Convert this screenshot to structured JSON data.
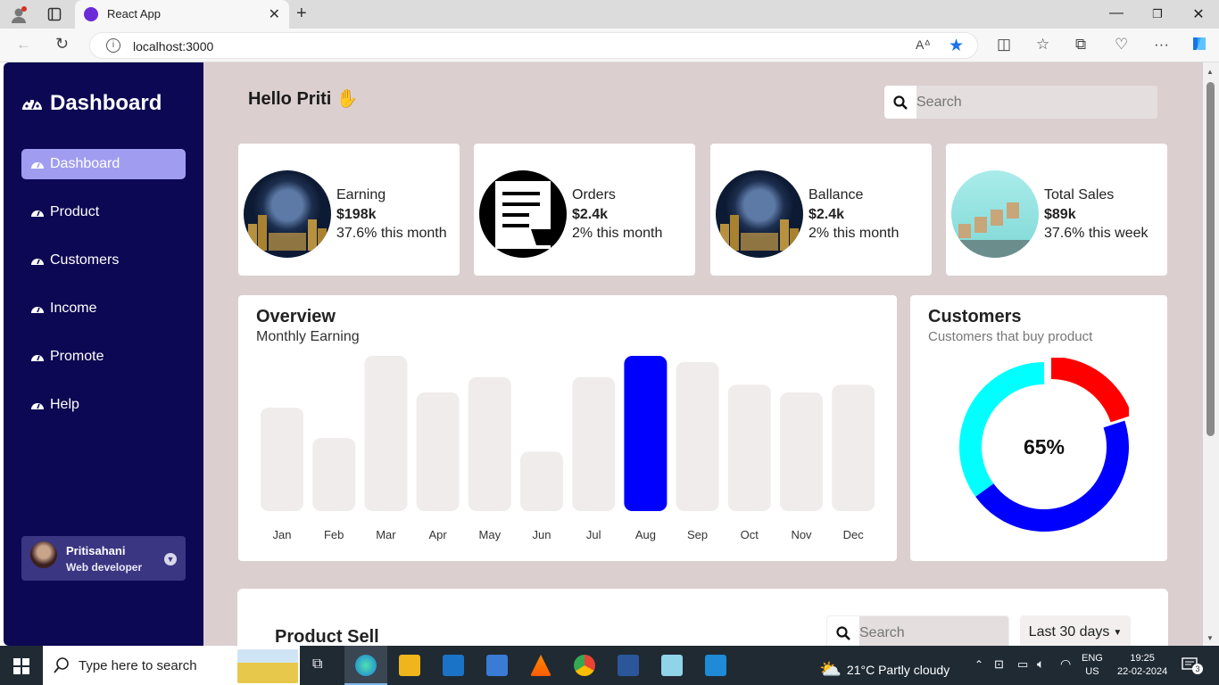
{
  "browser": {
    "tab_title": "React App",
    "url": "localhost:3000"
  },
  "sidebar": {
    "brand": "Dashboard",
    "items": [
      {
        "label": "Dashboard",
        "active": true
      },
      {
        "label": "Product"
      },
      {
        "label": "Customers"
      },
      {
        "label": "Income"
      },
      {
        "label": "Promote"
      },
      {
        "label": "Help"
      }
    ],
    "profile": {
      "name": "Pritisahani",
      "role": "Web developer"
    }
  },
  "header": {
    "greeting": "Hello Priti",
    "search_placeholder": "Search"
  },
  "cards": [
    {
      "label": "Earning",
      "value": "$198k",
      "sub": "37.6% this month"
    },
    {
      "label": "Orders",
      "value": "$2.4k",
      "sub": "2% this month"
    },
    {
      "label": "Ballance",
      "value": "$2.4k",
      "sub": "2% this month"
    },
    {
      "label": "Total Sales",
      "value": "$89k",
      "sub": "37.6% this week"
    }
  ],
  "overview": {
    "title": "Overview",
    "subtitle": "Monthly Earning"
  },
  "customers": {
    "title": "Customers",
    "subtitle": "Customers that buy product",
    "percent_label": "65%"
  },
  "product": {
    "title": "Product Sell",
    "search_placeholder": "Search",
    "range": "Last 30 days"
  },
  "taskbar": {
    "search_placeholder": "Type here to search",
    "weather": "21°C  Partly cloudy",
    "lang_1": "ENG",
    "lang_2": "US",
    "time": "19:25",
    "date": "22-02-2024",
    "notifications": "3"
  },
  "colors": {
    "sidebar_bg": "#0c0853",
    "active_item": "#a09df0",
    "highlight_bar": "#0000ff",
    "muted_bar": "#f0ecec",
    "donut_red": "#ff0000",
    "donut_blue": "#0000ff",
    "donut_cyan": "#00ffff"
  },
  "chart_data": [
    {
      "type": "bar",
      "categories": [
        "Jan",
        "Feb",
        "Mar",
        "Apr",
        "May",
        "Jun",
        "Jul",
        "Aug",
        "Sep",
        "Oct",
        "Nov",
        "Dec"
      ],
      "values": [
        6.8,
        4.8,
        10.2,
        7.8,
        8.8,
        3.9,
        8.8,
        10.2,
        9.8,
        8.3,
        7.8,
        8.3
      ],
      "highlight": "Aug",
      "ylim": [
        0,
        10.2
      ]
    },
    {
      "type": "pie",
      "style": "donut",
      "values": [
        20,
        45,
        35
      ],
      "colors": [
        "#ff0000",
        "#0000ff",
        "#00ffff"
      ],
      "center_label": "65%"
    }
  ]
}
